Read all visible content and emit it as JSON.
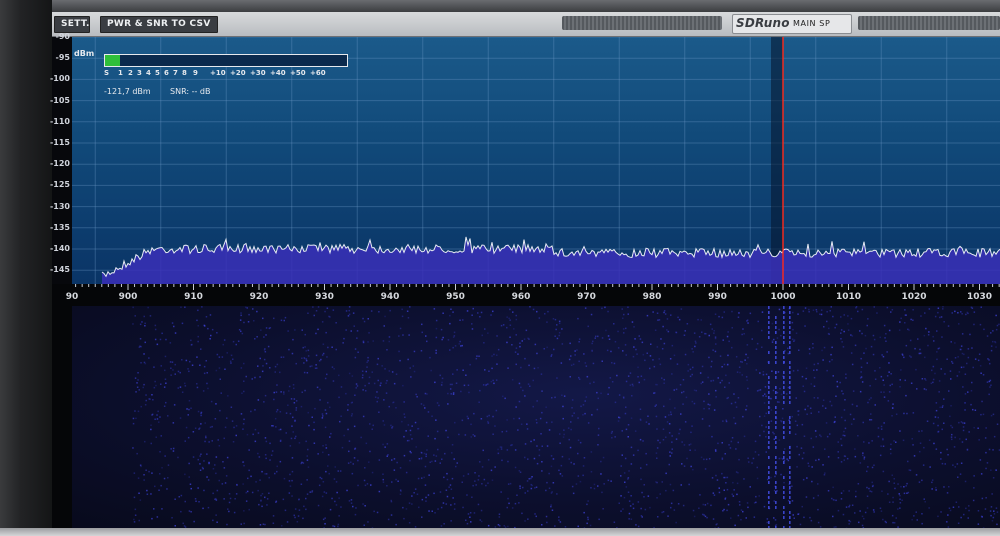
{
  "toolbar": {
    "sett_label": "SETT.",
    "pwr_snr_label": "PWR & SNR TO CSV",
    "brand_logo": "SDRuno",
    "panel_name": "MAIN SP"
  },
  "spectrum": {
    "y_unit": "dBm",
    "y_labels": [
      "-90",
      "-95",
      "-100",
      "-105",
      "-110",
      "-115",
      "-120",
      "-125",
      "-130",
      "-135",
      "-140",
      "-145"
    ],
    "noise_floor_dbm": -140,
    "tuned_frequency": 1000
  },
  "smeter": {
    "scale": [
      "S",
      "1",
      "2",
      "3",
      "4",
      "5",
      "6",
      "7",
      "8",
      "9",
      "+10",
      "+20",
      "+30",
      "+40",
      "+50",
      "+60"
    ],
    "level_fraction": 0.06,
    "power_readout": "-121,7 dBm",
    "snr_readout": "SNR: -- dB"
  },
  "freq_axis": {
    "labels": [
      "90",
      "900",
      "910",
      "920",
      "930",
      "940",
      "950",
      "960",
      "970",
      "980",
      "990",
      "1000",
      "1010",
      "1020",
      "1030"
    ]
  },
  "colors": {
    "trace": "#e8ecf4",
    "fill": "#3a2fb8",
    "tuning_line": "#ff2a1a",
    "smeter_fill": "#2fbf3a"
  }
}
